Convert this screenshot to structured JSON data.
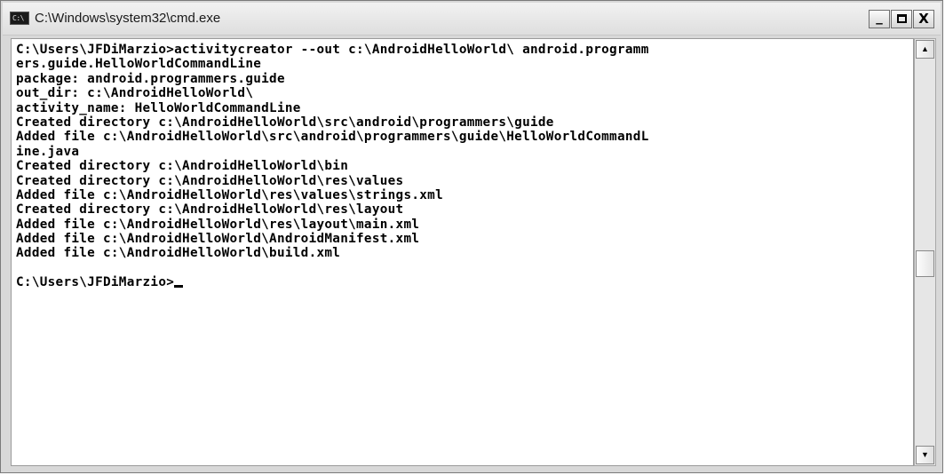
{
  "window": {
    "title": "C:\\Windows\\system32\\cmd.exe",
    "app_icon_text": "C:\\",
    "icon": "cmd-icon",
    "controls": {
      "minimize": "_",
      "maximize": "□",
      "close": "X"
    }
  },
  "console": {
    "lines": [
      "C:\\Users\\JFDiMarzio>activitycreator --out c:\\AndroidHelloWorld\\ android.programm",
      "ers.guide.HelloWorldCommandLine",
      "package: android.programmers.guide",
      "out_dir: c:\\AndroidHelloWorld\\",
      "activity_name: HelloWorldCommandLine",
      "Created directory c:\\AndroidHelloWorld\\src\\android\\programmers\\guide",
      "Added file c:\\AndroidHelloWorld\\src\\android\\programmers\\guide\\HelloWorldCommandL",
      "ine.java",
      "Created directory c:\\AndroidHelloWorld\\bin",
      "Created directory c:\\AndroidHelloWorld\\res\\values",
      "Added file c:\\AndroidHelloWorld\\res\\values\\strings.xml",
      "Created directory c:\\AndroidHelloWorld\\res\\layout",
      "Added file c:\\AndroidHelloWorld\\res\\layout\\main.xml",
      "Added file c:\\AndroidHelloWorld\\AndroidManifest.xml",
      "Added file c:\\AndroidHelloWorld\\build.xml",
      "",
      "C:\\Users\\JFDiMarzio>"
    ]
  },
  "scrollbar": {
    "up_arrow": "▲",
    "down_arrow": "▼"
  }
}
